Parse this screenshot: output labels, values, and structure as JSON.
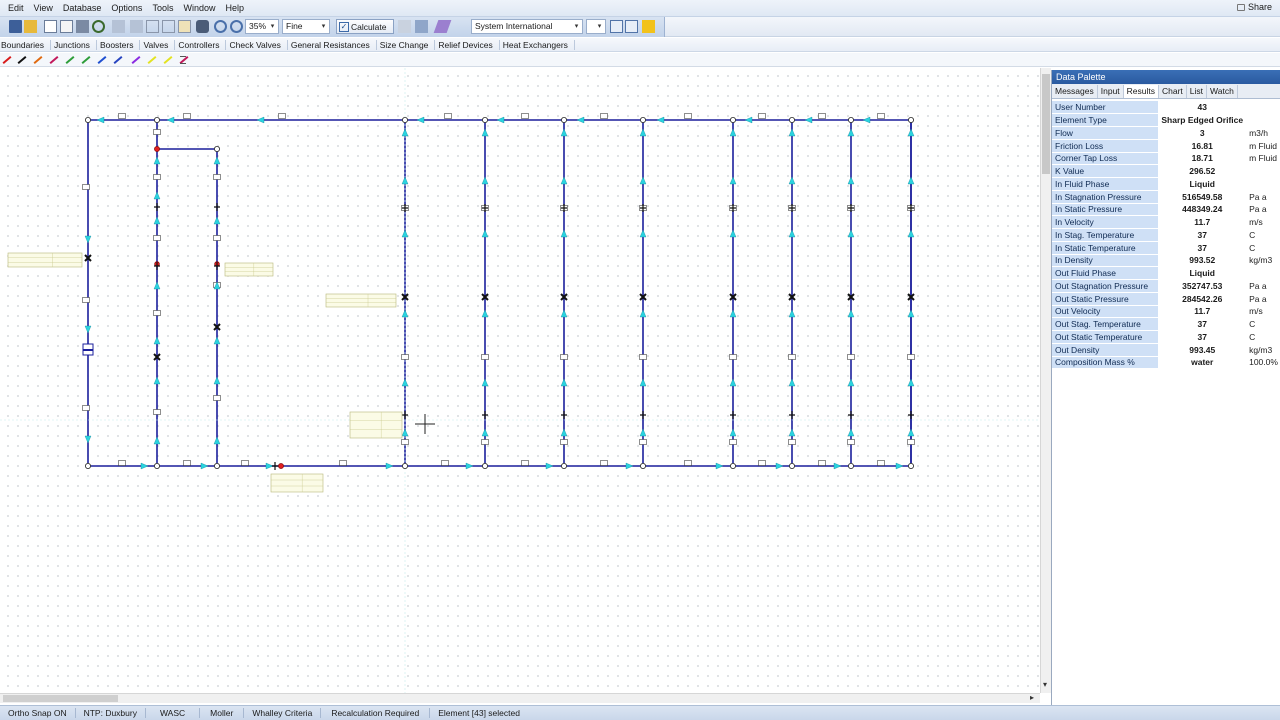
{
  "menu": [
    "Edit",
    "View",
    "Database",
    "Options",
    "Tools",
    "Window",
    "Help"
  ],
  "share_label": "Share",
  "toolbar": {
    "zoom": "35%",
    "quality": "Fine",
    "calculate_label": "Calculate",
    "units_system": "System International"
  },
  "categories": [
    "Boundaries",
    "Junctions",
    "Boosters",
    "Valves",
    "Controllers",
    "Check Valves",
    "General Resistances",
    "Size Change",
    "Relief Devices",
    "Heat Exchangers"
  ],
  "pipe_colors": [
    "#d81b1b",
    "#111111",
    "#e06a10",
    "#c2185b",
    "#2e9d3a",
    "#2e9d3a",
    "#1f4fd0",
    "#2744c0",
    "#8a2be2",
    "#e3e322",
    "#e3e322",
    "#c2185b"
  ],
  "palette": {
    "title": "Data Palette",
    "tabs": [
      "Messages",
      "Input",
      "Results",
      "Chart",
      "List",
      "Watch"
    ],
    "active_tab": "Results",
    "rows": [
      {
        "label": "User Number",
        "value": "43",
        "unit": ""
      },
      {
        "label": "Element Type",
        "value": "Sharp Edged Orifice",
        "unit": ""
      },
      {
        "label": "Flow",
        "value": "3",
        "unit": "m3/h"
      },
      {
        "label": "Friction Loss",
        "value": "16.81",
        "unit": "m Fluid"
      },
      {
        "label": "Corner Tap Loss",
        "value": "18.71",
        "unit": "m Fluid"
      },
      {
        "label": "K Value",
        "value": "296.52",
        "unit": ""
      },
      {
        "label": "In Fluid Phase",
        "value": "Liquid",
        "unit": ""
      },
      {
        "label": "In Stagnation Pressure",
        "value": "516549.58",
        "unit": "Pa a"
      },
      {
        "label": "In Static Pressure",
        "value": "448349.24",
        "unit": "Pa a"
      },
      {
        "label": "In Velocity",
        "value": "11.7",
        "unit": "m/s"
      },
      {
        "label": "In Stag. Temperature",
        "value": "37",
        "unit": "C"
      },
      {
        "label": "In Static Temperature",
        "value": "37",
        "unit": "C"
      },
      {
        "label": "In Density",
        "value": "993.52",
        "unit": "kg/m3"
      },
      {
        "label": "Out Fluid Phase",
        "value": "Liquid",
        "unit": ""
      },
      {
        "label": "Out Stagnation Pressure",
        "value": "352747.53",
        "unit": "Pa a"
      },
      {
        "label": "Out Static Pressure",
        "value": "284542.26",
        "unit": "Pa a"
      },
      {
        "label": "Out Velocity",
        "value": "11.7",
        "unit": "m/s"
      },
      {
        "label": "Out Stag. Temperature",
        "value": "37",
        "unit": "C"
      },
      {
        "label": "Out Static Temperature",
        "value": "37",
        "unit": "C"
      },
      {
        "label": "Out Density",
        "value": "993.45",
        "unit": "kg/m3"
      },
      {
        "label": "Composition Mass %",
        "value": "water",
        "unit": "100.0%"
      }
    ]
  },
  "status": [
    "Ortho Snap ON",
    "NTP: Duxbury",
    "WASC",
    "Moller",
    "Whalley Criteria",
    "Recalculation Required",
    "Element [43] selected"
  ],
  "canvas": {
    "pipe_color": "#1b1f9c",
    "flow_arrow_color": "#2ad4e0"
  }
}
